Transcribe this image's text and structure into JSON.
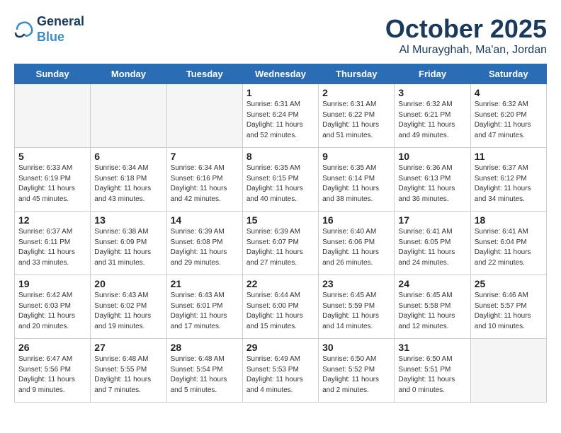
{
  "header": {
    "logo_line1": "General",
    "logo_line2": "Blue",
    "month": "October 2025",
    "location": "Al Murayghah, Ma'an, Jordan"
  },
  "weekdays": [
    "Sunday",
    "Monday",
    "Tuesday",
    "Wednesday",
    "Thursday",
    "Friday",
    "Saturday"
  ],
  "weeks": [
    [
      {
        "day": "",
        "sunrise": "",
        "sunset": "",
        "daylight": "",
        "empty": true
      },
      {
        "day": "",
        "sunrise": "",
        "sunset": "",
        "daylight": "",
        "empty": true
      },
      {
        "day": "",
        "sunrise": "",
        "sunset": "",
        "daylight": "",
        "empty": true
      },
      {
        "day": "1",
        "sunrise": "Sunrise: 6:31 AM",
        "sunset": "Sunset: 6:24 PM",
        "daylight": "Daylight: 11 hours and 52 minutes."
      },
      {
        "day": "2",
        "sunrise": "Sunrise: 6:31 AM",
        "sunset": "Sunset: 6:22 PM",
        "daylight": "Daylight: 11 hours and 51 minutes."
      },
      {
        "day": "3",
        "sunrise": "Sunrise: 6:32 AM",
        "sunset": "Sunset: 6:21 PM",
        "daylight": "Daylight: 11 hours and 49 minutes."
      },
      {
        "day": "4",
        "sunrise": "Sunrise: 6:32 AM",
        "sunset": "Sunset: 6:20 PM",
        "daylight": "Daylight: 11 hours and 47 minutes."
      }
    ],
    [
      {
        "day": "5",
        "sunrise": "Sunrise: 6:33 AM",
        "sunset": "Sunset: 6:19 PM",
        "daylight": "Daylight: 11 hours and 45 minutes."
      },
      {
        "day": "6",
        "sunrise": "Sunrise: 6:34 AM",
        "sunset": "Sunset: 6:18 PM",
        "daylight": "Daylight: 11 hours and 43 minutes."
      },
      {
        "day": "7",
        "sunrise": "Sunrise: 6:34 AM",
        "sunset": "Sunset: 6:16 PM",
        "daylight": "Daylight: 11 hours and 42 minutes."
      },
      {
        "day": "8",
        "sunrise": "Sunrise: 6:35 AM",
        "sunset": "Sunset: 6:15 PM",
        "daylight": "Daylight: 11 hours and 40 minutes."
      },
      {
        "day": "9",
        "sunrise": "Sunrise: 6:35 AM",
        "sunset": "Sunset: 6:14 PM",
        "daylight": "Daylight: 11 hours and 38 minutes."
      },
      {
        "day": "10",
        "sunrise": "Sunrise: 6:36 AM",
        "sunset": "Sunset: 6:13 PM",
        "daylight": "Daylight: 11 hours and 36 minutes."
      },
      {
        "day": "11",
        "sunrise": "Sunrise: 6:37 AM",
        "sunset": "Sunset: 6:12 PM",
        "daylight": "Daylight: 11 hours and 34 minutes."
      }
    ],
    [
      {
        "day": "12",
        "sunrise": "Sunrise: 6:37 AM",
        "sunset": "Sunset: 6:11 PM",
        "daylight": "Daylight: 11 hours and 33 minutes."
      },
      {
        "day": "13",
        "sunrise": "Sunrise: 6:38 AM",
        "sunset": "Sunset: 6:09 PM",
        "daylight": "Daylight: 11 hours and 31 minutes."
      },
      {
        "day": "14",
        "sunrise": "Sunrise: 6:39 AM",
        "sunset": "Sunset: 6:08 PM",
        "daylight": "Daylight: 11 hours and 29 minutes."
      },
      {
        "day": "15",
        "sunrise": "Sunrise: 6:39 AM",
        "sunset": "Sunset: 6:07 PM",
        "daylight": "Daylight: 11 hours and 27 minutes."
      },
      {
        "day": "16",
        "sunrise": "Sunrise: 6:40 AM",
        "sunset": "Sunset: 6:06 PM",
        "daylight": "Daylight: 11 hours and 26 minutes."
      },
      {
        "day": "17",
        "sunrise": "Sunrise: 6:41 AM",
        "sunset": "Sunset: 6:05 PM",
        "daylight": "Daylight: 11 hours and 24 minutes."
      },
      {
        "day": "18",
        "sunrise": "Sunrise: 6:41 AM",
        "sunset": "Sunset: 6:04 PM",
        "daylight": "Daylight: 11 hours and 22 minutes."
      }
    ],
    [
      {
        "day": "19",
        "sunrise": "Sunrise: 6:42 AM",
        "sunset": "Sunset: 6:03 PM",
        "daylight": "Daylight: 11 hours and 20 minutes."
      },
      {
        "day": "20",
        "sunrise": "Sunrise: 6:43 AM",
        "sunset": "Sunset: 6:02 PM",
        "daylight": "Daylight: 11 hours and 19 minutes."
      },
      {
        "day": "21",
        "sunrise": "Sunrise: 6:43 AM",
        "sunset": "Sunset: 6:01 PM",
        "daylight": "Daylight: 11 hours and 17 minutes."
      },
      {
        "day": "22",
        "sunrise": "Sunrise: 6:44 AM",
        "sunset": "Sunset: 6:00 PM",
        "daylight": "Daylight: 11 hours and 15 minutes."
      },
      {
        "day": "23",
        "sunrise": "Sunrise: 6:45 AM",
        "sunset": "Sunset: 5:59 PM",
        "daylight": "Daylight: 11 hours and 14 minutes."
      },
      {
        "day": "24",
        "sunrise": "Sunrise: 6:45 AM",
        "sunset": "Sunset: 5:58 PM",
        "daylight": "Daylight: 11 hours and 12 minutes."
      },
      {
        "day": "25",
        "sunrise": "Sunrise: 6:46 AM",
        "sunset": "Sunset: 5:57 PM",
        "daylight": "Daylight: 11 hours and 10 minutes."
      }
    ],
    [
      {
        "day": "26",
        "sunrise": "Sunrise: 6:47 AM",
        "sunset": "Sunset: 5:56 PM",
        "daylight": "Daylight: 11 hours and 9 minutes."
      },
      {
        "day": "27",
        "sunrise": "Sunrise: 6:48 AM",
        "sunset": "Sunset: 5:55 PM",
        "daylight": "Daylight: 11 hours and 7 minutes."
      },
      {
        "day": "28",
        "sunrise": "Sunrise: 6:48 AM",
        "sunset": "Sunset: 5:54 PM",
        "daylight": "Daylight: 11 hours and 5 minutes."
      },
      {
        "day": "29",
        "sunrise": "Sunrise: 6:49 AM",
        "sunset": "Sunset: 5:53 PM",
        "daylight": "Daylight: 11 hours and 4 minutes."
      },
      {
        "day": "30",
        "sunrise": "Sunrise: 6:50 AM",
        "sunset": "Sunset: 5:52 PM",
        "daylight": "Daylight: 11 hours and 2 minutes."
      },
      {
        "day": "31",
        "sunrise": "Sunrise: 6:50 AM",
        "sunset": "Sunset: 5:51 PM",
        "daylight": "Daylight: 11 hours and 0 minutes."
      },
      {
        "day": "",
        "sunrise": "",
        "sunset": "",
        "daylight": "",
        "empty": true
      }
    ]
  ]
}
